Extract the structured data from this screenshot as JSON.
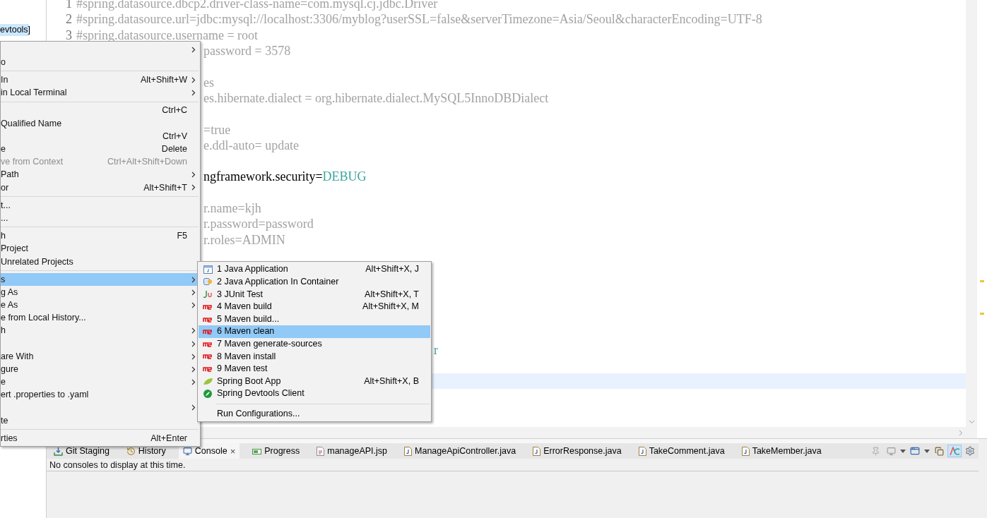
{
  "explorer": {
    "items": [
      {
        "label": "evtools]",
        "selected": true
      }
    ]
  },
  "editor": {
    "lines": [
      {
        "kind": "full",
        "number": "1",
        "current": false,
        "segments": [
          {
            "text": "#spring.datasource.dbcp2.driver-class-name=com.mysql.cj.jdbc.Driver",
            "kind": "comment"
          }
        ]
      },
      {
        "kind": "full",
        "number": "2",
        "current": false,
        "segments": [
          {
            "text": "#spring.datasource.url=jdbc:mysql://localhost:3306/myblog?userSSL=false&serverTimezone=Asia/Seoul&characterEncoding=UTF-8",
            "kind": "comment"
          }
        ]
      },
      {
        "kind": "full",
        "number": "3",
        "current": false,
        "segments": [
          {
            "text": "#spring.datasource.username = root",
            "kind": "comment"
          }
        ]
      },
      {
        "kind": "after-menu",
        "current": false,
        "segments": [
          {
            "text": "password = 3578",
            "kind": "comment"
          }
        ]
      },
      {
        "kind": "blank",
        "current": false
      },
      {
        "kind": "after-menu",
        "current": false,
        "segments": [
          {
            "text": "es",
            "kind": "comment"
          }
        ]
      },
      {
        "kind": "after-menu",
        "current": false,
        "segments": [
          {
            "text": "es.hibernate.dialect = org.hibernate.dialect.MySQL5InnoDBDialect",
            "kind": "comment"
          }
        ]
      },
      {
        "kind": "blank",
        "current": false
      },
      {
        "kind": "after-menu",
        "current": false,
        "segments": [
          {
            "text": "=true",
            "kind": "comment"
          }
        ]
      },
      {
        "kind": "after-menu",
        "current": false,
        "segments": [
          {
            "text": "e.ddl-auto= update",
            "kind": "comment"
          }
        ]
      },
      {
        "kind": "blank",
        "current": false
      },
      {
        "kind": "after-menu",
        "current": false,
        "segments": [
          {
            "text": "ngframework.security=",
            "kind": "key"
          },
          {
            "text": "DEBUG",
            "kind": "value"
          }
        ]
      },
      {
        "kind": "blank",
        "current": false
      },
      {
        "kind": "after-menu",
        "current": false,
        "segments": [
          {
            "text": "r.name=kjh",
            "kind": "comment"
          }
        ]
      },
      {
        "kind": "after-menu",
        "current": false,
        "segments": [
          {
            "text": "r.password=password",
            "kind": "comment"
          }
        ]
      },
      {
        "kind": "after-menu",
        "current": false,
        "segments": [
          {
            "text": "r.roles=ADMIN",
            "kind": "comment"
          }
        ]
      },
      {
        "kind": "blank",
        "current": false
      },
      {
        "kind": "blank",
        "current": false
      },
      {
        "kind": "blank",
        "current": false
      },
      {
        "kind": "blank",
        "current": false
      },
      {
        "kind": "blank",
        "current": false
      },
      {
        "kind": "blank",
        "current": false
      },
      {
        "kind": "after-submenu",
        "current": false,
        "segments": [
          {
            "text": "r",
            "kind": "value"
          }
        ]
      },
      {
        "kind": "blank",
        "current": false
      },
      {
        "kind": "blank",
        "current": true
      }
    ]
  },
  "context_menu": {
    "items": [
      {
        "kind": "item",
        "submenu": true,
        "selected": false,
        "disabled": false
      },
      {
        "kind": "item",
        "label": "o",
        "submenu": false,
        "selected": false,
        "disabled": false
      },
      {
        "kind": "separator"
      },
      {
        "kind": "item",
        "label": "In",
        "shortcut": "Alt+Shift+W",
        "submenu": true,
        "selected": false,
        "disabled": false
      },
      {
        "kind": "item",
        "label": "in Local Terminal",
        "submenu": true,
        "selected": false,
        "disabled": false
      },
      {
        "kind": "separator"
      },
      {
        "kind": "item",
        "shortcut": "Ctrl+C",
        "submenu": false,
        "selected": false,
        "disabled": false
      },
      {
        "kind": "item",
        "label": "Qualified Name",
        "submenu": false,
        "selected": false,
        "disabled": false
      },
      {
        "kind": "item",
        "shortcut": "Ctrl+V",
        "submenu": false,
        "selected": false,
        "disabled": false
      },
      {
        "kind": "item",
        "label": "e",
        "shortcut": "Delete",
        "submenu": false,
        "selected": false,
        "disabled": false
      },
      {
        "kind": "item",
        "label": "ve from Context",
        "shortcut": "Ctrl+Alt+Shift+Down",
        "submenu": false,
        "selected": false,
        "disabled": true
      },
      {
        "kind": "item",
        "label": "Path",
        "submenu": true,
        "selected": false,
        "disabled": false
      },
      {
        "kind": "item",
        "label": "or",
        "shortcut": "Alt+Shift+T",
        "submenu": true,
        "selected": false,
        "disabled": false
      },
      {
        "kind": "separator"
      },
      {
        "kind": "item",
        "label": "t...",
        "submenu": false,
        "selected": false,
        "disabled": false
      },
      {
        "kind": "item",
        "label": "...",
        "submenu": false,
        "selected": false,
        "disabled": false
      },
      {
        "kind": "separator"
      },
      {
        "kind": "item",
        "label": "h",
        "shortcut": "F5",
        "submenu": false,
        "selected": false,
        "disabled": false
      },
      {
        "kind": "item",
        "label": "Project",
        "submenu": false,
        "selected": false,
        "disabled": false
      },
      {
        "kind": "item",
        "label": "Unrelated Projects",
        "submenu": false,
        "selected": false,
        "disabled": false
      },
      {
        "kind": "separator"
      },
      {
        "kind": "item",
        "label": "s",
        "submenu": true,
        "selected": true,
        "disabled": false
      },
      {
        "kind": "item",
        "label": "g As",
        "submenu": true,
        "selected": false,
        "disabled": false
      },
      {
        "kind": "item",
        "label": "e As",
        "submenu": true,
        "selected": false,
        "disabled": false
      },
      {
        "kind": "item",
        "label": "e from Local History...",
        "submenu": false,
        "selected": false,
        "disabled": false
      },
      {
        "kind": "item",
        "label": "h",
        "submenu": true,
        "selected": false,
        "disabled": false
      },
      {
        "kind": "item",
        "submenu": true,
        "selected": false,
        "disabled": false
      },
      {
        "kind": "item",
        "label": "are With",
        "submenu": true,
        "selected": false,
        "disabled": false
      },
      {
        "kind": "item",
        "label": "gure",
        "submenu": true,
        "selected": false,
        "disabled": false
      },
      {
        "kind": "item",
        "label": "e",
        "submenu": true,
        "selected": false,
        "disabled": false
      },
      {
        "kind": "item",
        "label": "ert .properties to .yaml",
        "submenu": false,
        "selected": false,
        "disabled": false
      },
      {
        "kind": "item",
        "submenu": true,
        "selected": false,
        "disabled": false
      },
      {
        "kind": "item",
        "label": "te",
        "submenu": false,
        "selected": false,
        "disabled": false
      },
      {
        "kind": "separator"
      },
      {
        "kind": "item",
        "label": "rties",
        "shortcut": "Alt+Enter",
        "submenu": false,
        "selected": false,
        "disabled": false
      }
    ]
  },
  "submenu": {
    "items": [
      {
        "kind": "java",
        "label": "1 Java Application",
        "shortcut": "Alt+Shift+X, J",
        "selected": false
      },
      {
        "kind": "container",
        "label": "2 Java Application In Container",
        "selected": false
      },
      {
        "kind": "junit",
        "label": "3 JUnit Test",
        "shortcut": "Alt+Shift+X, T",
        "selected": false
      },
      {
        "kind": "maven",
        "label": "4 Maven build",
        "shortcut": "Alt+Shift+X, M",
        "selected": false
      },
      {
        "kind": "maven",
        "label": "5 Maven build...",
        "selected": false
      },
      {
        "kind": "maven",
        "label": "6 Maven clean",
        "selected": true
      },
      {
        "kind": "maven",
        "label": "7 Maven generate-sources",
        "selected": false
      },
      {
        "kind": "maven",
        "label": "8 Maven install",
        "selected": false
      },
      {
        "kind": "maven",
        "label": "9 Maven test",
        "selected": false
      },
      {
        "kind": "spring-boot",
        "label": "Spring Boot App",
        "shortcut": "Alt+Shift+X, B",
        "selected": false
      },
      {
        "kind": "devtools",
        "label": "Spring Devtools Client",
        "selected": false
      },
      {
        "kind": "separator"
      },
      {
        "kind": "plain",
        "label": "Run Configurations...",
        "selected": false
      }
    ]
  },
  "bottom_panel": {
    "tabs": [
      {
        "kind": "git",
        "label": "Git Staging",
        "selected": false
      },
      {
        "kind": "history",
        "label": "History",
        "selected": false
      },
      {
        "kind": "console",
        "label": "Console",
        "selected": true,
        "close": "×"
      },
      {
        "kind": "progress",
        "label": "Progress",
        "selected": false
      },
      {
        "kind": "jsp",
        "label": "manageAPI.jsp",
        "selected": false
      },
      {
        "kind": "java",
        "label": "ManageApiController.java",
        "selected": false
      },
      {
        "kind": "java",
        "label": "ErrorResponse.java",
        "selected": false
      },
      {
        "kind": "java",
        "label": "TakeComment.java",
        "selected": false
      },
      {
        "kind": "java",
        "label": "TakeMember.java",
        "selected": false
      }
    ],
    "toolbar": [
      {
        "kind": "pin",
        "on": false
      },
      {
        "kind": "display",
        "on": false
      },
      {
        "kind": "dropdown",
        "on": false
      },
      {
        "kind": "new-console",
        "on": false
      },
      {
        "kind": "dropdown",
        "on": false
      },
      {
        "kind": "copy",
        "on": false
      },
      {
        "kind": "word-wrap",
        "on": true
      },
      {
        "kind": "settings",
        "on": false
      }
    ],
    "message": "No consoles to display at this time."
  }
}
